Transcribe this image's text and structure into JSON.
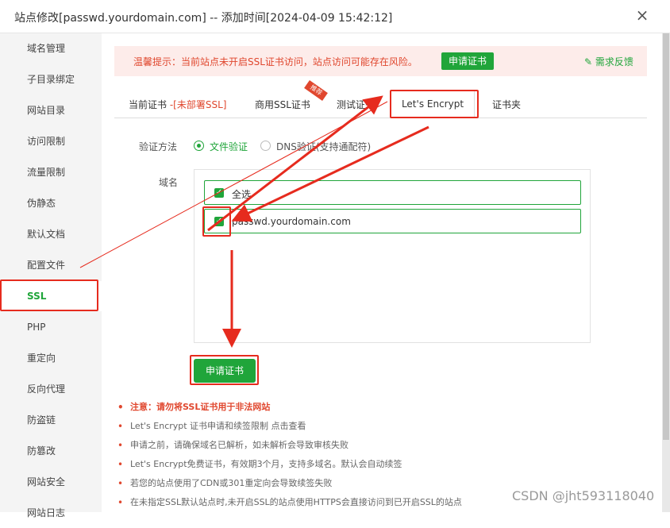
{
  "window": {
    "title": "站点修改[passwd.yourdomain.com] -- 添加时间[2024-04-09 15:42:12]",
    "close_glyph": "×"
  },
  "sidebar": {
    "items": [
      {
        "label": "域名管理"
      },
      {
        "label": "子目录绑定"
      },
      {
        "label": "网站目录"
      },
      {
        "label": "访问限制"
      },
      {
        "label": "流量限制"
      },
      {
        "label": "伪静态"
      },
      {
        "label": "默认文档"
      },
      {
        "label": "配置文件"
      },
      {
        "label": "SSL"
      },
      {
        "label": "PHP"
      },
      {
        "label": "重定向"
      },
      {
        "label": "反向代理"
      },
      {
        "label": "防盗链"
      },
      {
        "label": "防篡改"
      },
      {
        "label": "网站安全"
      },
      {
        "label": "网站日志"
      }
    ],
    "active": "SSL"
  },
  "warning": {
    "text": "温馨提示：当前站点未开启SSL证书访问，站点访问可能存在风险。",
    "apply_label": "申请证书",
    "feedback_label": "需求反馈"
  },
  "tabs": {
    "current_cert": "当前证书",
    "current_status": "-[未部署SSL]",
    "commercial": "商用SSL证书",
    "ribbon": "推荐",
    "test": "测试证书",
    "letsencrypt": "Let's Encrypt",
    "folder": "证书夹"
  },
  "form": {
    "verify_label": "验证方法",
    "file_verify": "文件验证",
    "dns_verify": "DNS验证(支持通配符)",
    "domain_label": "域名",
    "select_all": "全选",
    "domain": "passwd.yourdomain.com",
    "apply_label": "申请证书"
  },
  "notes": [
    "注意：请勿将SSL证书用于非法网站",
    "Let's Encrypt 证书申请和续签限制 点击查看",
    "申请之前，请确保域名已解析，如未解析会导致审核失败",
    "Let's Encrypt免费证书，有效期3个月，支持多域名。默认会自动续签",
    "若您的站点使用了CDN或301重定向会导致续签失败",
    "在未指定SSL默认站点时,未开启SSL的站点使用HTTPS会直接访问到已开启SSL的站点"
  ],
  "watermark": "CSDN @jht593118040",
  "colors": {
    "accent": "#20a53a",
    "warning": "#e0472e",
    "annotation": "#e62b1e"
  }
}
